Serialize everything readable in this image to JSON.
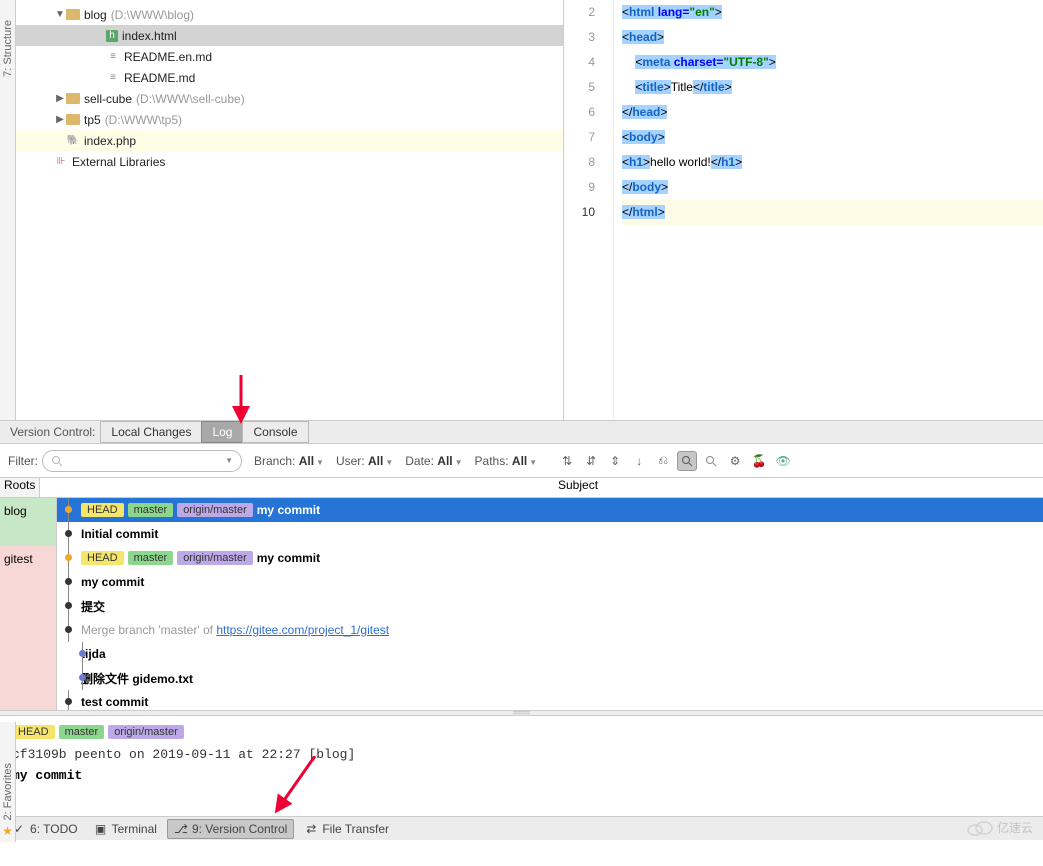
{
  "sidebar_left": {
    "structure": "7: Structure",
    "favorites": "2: Favorites"
  },
  "tree": [
    {
      "indent": 38,
      "arrow": "▼",
      "icon": "folder",
      "label": "blog",
      "hint": "(D:\\WWW\\blog)",
      "sel": false
    },
    {
      "indent": 78,
      "arrow": "",
      "icon": "html",
      "label": "index.html",
      "hint": "",
      "sel": true
    },
    {
      "indent": 78,
      "arrow": "",
      "icon": "md",
      "label": "README.en.md",
      "hint": "",
      "sel": false
    },
    {
      "indent": 78,
      "arrow": "",
      "icon": "md",
      "label": "README.md",
      "hint": "",
      "sel": false
    },
    {
      "indent": 38,
      "arrow": "▶",
      "icon": "folder",
      "label": "sell-cube",
      "hint": "(D:\\WWW\\sell-cube)",
      "sel": false
    },
    {
      "indent": 38,
      "arrow": "▶",
      "icon": "folder",
      "label": "tp5",
      "hint": "(D:\\WWW\\tp5)",
      "sel": false
    },
    {
      "indent": 38,
      "arrow": "",
      "icon": "php",
      "label": "index.php",
      "hint": "",
      "sel": false,
      "hl": true
    },
    {
      "indent": 26,
      "arrow": "",
      "icon": "lib",
      "label": "External Libraries",
      "hint": "",
      "sel": false
    }
  ],
  "editor": {
    "lines": [
      {
        "n": 2,
        "html": "<span class='sel-bg'>&lt;<span class='t-tag'>html</span> <span class='t-attr'>lang=</span><span class='t-val'>\"en\"</span>&gt;</span>"
      },
      {
        "n": 3,
        "html": "<span class='sel-bg'>&lt;<span class='t-tag'>head</span>&gt;</span>"
      },
      {
        "n": 4,
        "html": "    <span class='sel-bg'>&lt;<span class='t-tag'>meta</span> <span class='t-attr'>charset=</span><span class='t-val'>\"UTF-8\"</span>&gt;</span>"
      },
      {
        "n": 5,
        "html": "    <span class='sel-bg'>&lt;<span class='t-tag'>title</span>&gt;</span>Title<span class='sel-bg'>&lt;/<span class='t-tag'>title</span>&gt;</span>"
      },
      {
        "n": 6,
        "html": "<span class='sel-bg'>&lt;/<span class='t-tag'>head</span>&gt;</span>"
      },
      {
        "n": 7,
        "html": "<span class='sel-bg'>&lt;<span class='t-tag'>body</span>&gt;</span>"
      },
      {
        "n": 8,
        "html": "<span class='sel-bg'>&lt;<span class='t-tag'>h1</span>&gt;</span>hello world!<span class='sel-bg'>&lt;/<span class='t-tag'>h1</span>&gt;</span>"
      },
      {
        "n": 9,
        "html": "<span class='sel-bg'>&lt;/<span class='t-tag'>body</span>&gt;</span>"
      },
      {
        "n": 10,
        "html": "<span class='sel-bg'>&lt;/<span class='t-tag'>html</span>&gt;</span>",
        "cur": true
      }
    ]
  },
  "vc": {
    "label": "Version Control:",
    "tabs": [
      "Local Changes",
      "Log",
      "Console"
    ],
    "active_tab": 1,
    "filter_label": "Filter:",
    "branch": {
      "lbl": "Branch:",
      "val": "All"
    },
    "user": {
      "lbl": "User:",
      "val": "All"
    },
    "date": {
      "lbl": "Date:",
      "val": "All"
    },
    "paths": {
      "lbl": "Paths:",
      "val": "All"
    },
    "header": {
      "roots": "Roots",
      "subject": "Subject"
    },
    "roots": [
      "blog",
      "gitest"
    ],
    "commits": [
      {
        "root": 0,
        "sel": true,
        "badges": [
          "HEAD",
          "master",
          "origin/master"
        ],
        "msg": "my commit",
        "dot": "#f5a623",
        "x": 4
      },
      {
        "root": 0,
        "msg": "Initial commit",
        "dot": "#333",
        "x": 4
      },
      {
        "root": 1,
        "badges": [
          "HEAD",
          "master",
          "origin/master"
        ],
        "msg": "my commit",
        "dot": "#f5a623",
        "x": 4
      },
      {
        "root": 1,
        "msg": "my commit",
        "dot": "#333",
        "x": 4
      },
      {
        "root": 1,
        "msg": "提交",
        "dot": "#333",
        "x": 4
      },
      {
        "root": 1,
        "gray": true,
        "msg_pre": "Merge branch 'master' of ",
        "link": "https://gitee.com/project_1/gitest",
        "dot": "#333",
        "x": 4
      },
      {
        "root": 1,
        "msg": "tijda",
        "dot": "#6b7bd6",
        "x": 18
      },
      {
        "root": 1,
        "msg": "删除文件 gidemo.txt",
        "dot": "#6b7bd6",
        "x": 18
      },
      {
        "root": 1,
        "msg": "test commit",
        "dot": "#333",
        "x": 4
      }
    ],
    "detail": {
      "badges": [
        "HEAD",
        "master",
        "origin/master"
      ],
      "meta": "cf3109b peento on 2019-09-11 at 22:27 [blog]",
      "title": "my commit"
    }
  },
  "bottom": [
    {
      "icon": "todo",
      "label": "6: TODO"
    },
    {
      "icon": "term",
      "label": "Terminal"
    },
    {
      "icon": "vc",
      "label": "9: Version Control",
      "active": true
    },
    {
      "icon": "ft",
      "label": "File Transfer"
    }
  ],
  "watermark": "亿速云"
}
